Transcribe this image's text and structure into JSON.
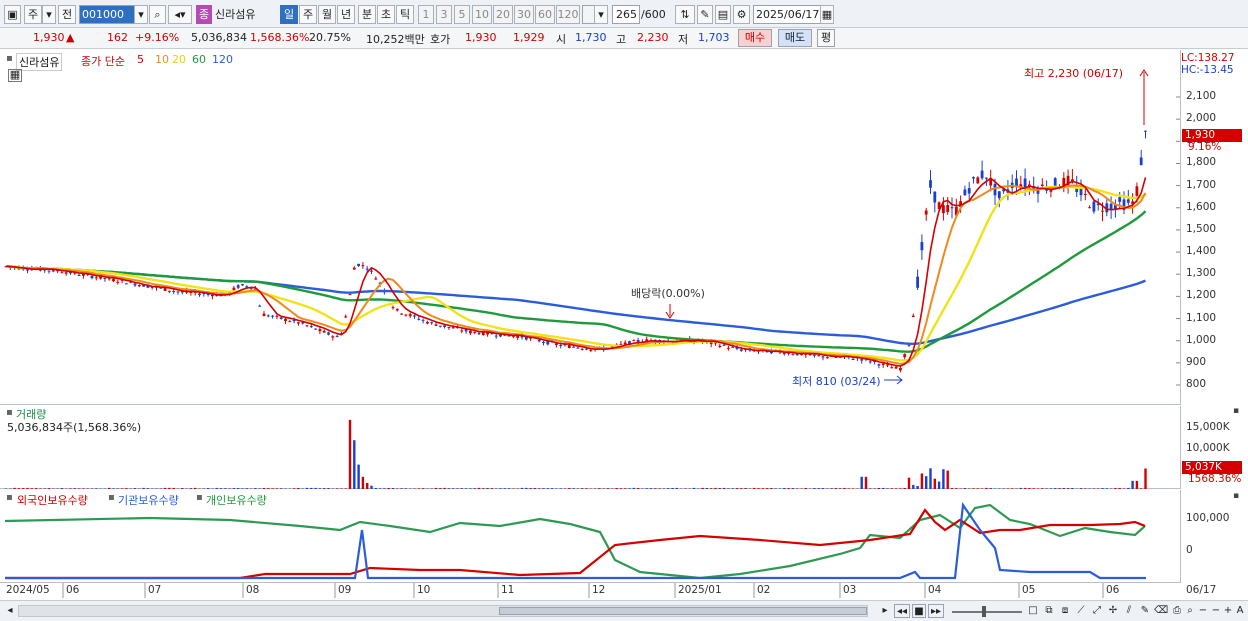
{
  "toolbar": {
    "market_btn": "주",
    "period_btn": "전",
    "code": "001000",
    "name_tag": "종",
    "name": "신라섬유",
    "periods": [
      "일",
      "주",
      "월",
      "년",
      "분",
      "초",
      "틱"
    ],
    "intervals": [
      "1",
      "3",
      "5",
      "10",
      "20",
      "30",
      "60",
      "120"
    ],
    "count": "265",
    "count_total": "/600",
    "date": "2025/06/17"
  },
  "quote": {
    "price": "1,930",
    "arrow": "▲",
    "change": "162",
    "change_pct": "+9.16%",
    "volume": "5,036,834",
    "volume_ratio": "1,568.36%",
    "turnover": "20.75%",
    "amount": "10,252백만",
    "ask_label": "호가",
    "ask": "1,930",
    "bid": "1,929",
    "open_label": "시",
    "open": "1,730",
    "high_label": "고",
    "high": "2,230",
    "low_label": "저",
    "low": "1,703",
    "buy": "매수",
    "sell": "매도",
    "eval": "평"
  },
  "price_panel": {
    "stock_label": "신라섬유",
    "ma_label": "종가 단순",
    "ma_periods": [
      "5",
      "10",
      "20",
      "60",
      "120"
    ],
    "ma_colors": [
      "#d40000",
      "#f08a1c",
      "#f2e21a",
      "#1e9a3c",
      "#2a5cdc"
    ],
    "lc": "LC:138.27",
    "hc": "HC:-13.45",
    "last_tag": "1,930",
    "last_pct": "9.16%",
    "high_note": "최고 2,230 (06/17)",
    "low_note": "최저 810 (03/24)",
    "dividend_note": "배당락(0.00%)",
    "y_ticks": [
      "2,100",
      "2,000",
      "1,900",
      "1,800",
      "1,700",
      "1,600",
      "1,500",
      "1,400",
      "1,300",
      "1,200",
      "1,100",
      "1,000",
      "900",
      "800"
    ]
  },
  "volume_panel": {
    "title": "거래량",
    "value": "5,036,834주(1,568.36%)",
    "y_ticks": [
      "15,000K",
      "10,000K"
    ],
    "last_tag": "5,037K",
    "last_pct": "1568.36%"
  },
  "holding_panel": {
    "foreign": "외국인보유수량",
    "institution": "기관보유수량",
    "individual": "개인보유수량",
    "y_ticks": [
      "100,000",
      "0"
    ]
  },
  "x_ticks": [
    "2024/05",
    "06",
    "07",
    "08",
    "09",
    "10",
    "11",
    "12",
    "2025/01",
    "02",
    "03",
    "04",
    "05",
    "06",
    "06/17"
  ],
  "colors": {
    "up": "#d40000",
    "down": "#1a3fcf",
    "accent": "#2f6fc0"
  }
}
